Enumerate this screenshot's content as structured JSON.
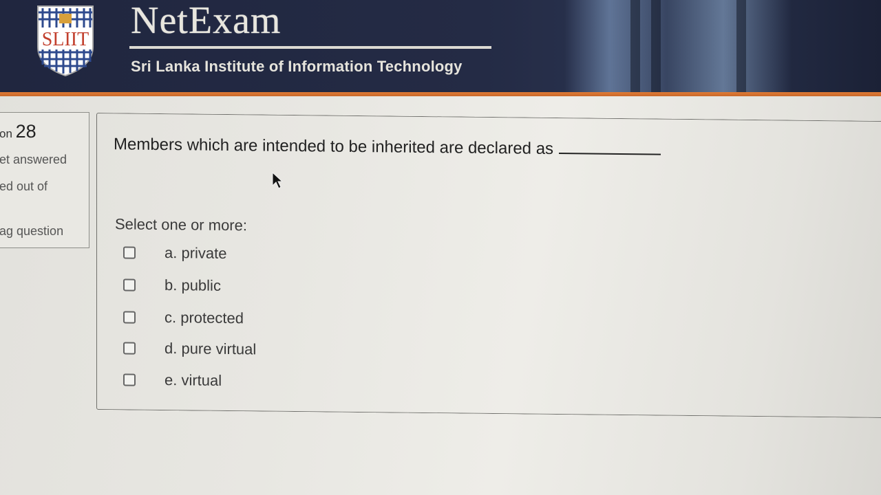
{
  "header": {
    "logo_text": "SLIIT",
    "title": "NetExam",
    "subtitle": "Sri Lanka Institute of Information Technology"
  },
  "info": {
    "question_prefix": "on",
    "question_number": "28",
    "status": "et answered",
    "marked": "ed out of",
    "flag": "ag question"
  },
  "question": {
    "text": "Members which are intended to be inherited are declared as",
    "prompt": "Select one or more:",
    "options": [
      {
        "label": "a. private",
        "checked": false
      },
      {
        "label": "b. public",
        "checked": false
      },
      {
        "label": "c. protected",
        "checked": false
      },
      {
        "label": "d. pure virtual",
        "checked": false
      },
      {
        "label": "e. virtual",
        "checked": false
      }
    ]
  },
  "colors": {
    "header_bg": "#20263f",
    "accent": "#e07b35",
    "logo_red": "#c2402e"
  }
}
